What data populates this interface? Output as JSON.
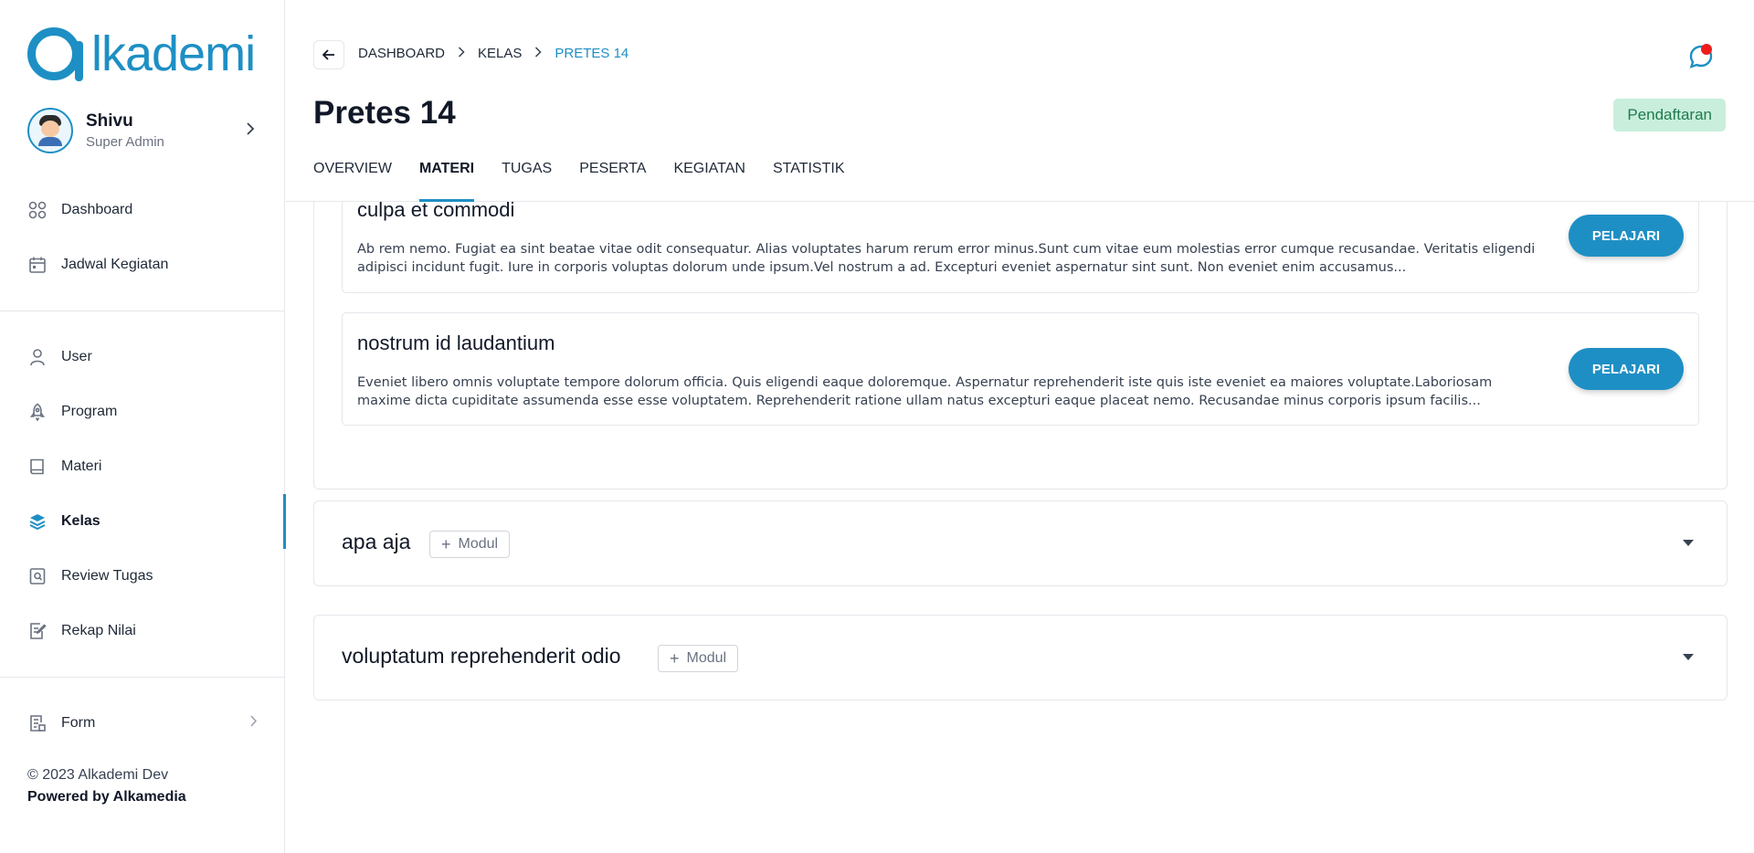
{
  "brand": {
    "logo_text": "lkademi",
    "accent_color": "#1e8fc4"
  },
  "profile": {
    "name": "Shivu",
    "role": "Super Admin"
  },
  "sidebar": {
    "primary": [
      {
        "label": "Dashboard",
        "icon": "dashboard-grid-icon"
      },
      {
        "label": "Jadwal Kegiatan",
        "icon": "calendar-icon"
      }
    ],
    "secondary": [
      {
        "label": "User",
        "icon": "user-icon"
      },
      {
        "label": "Program",
        "icon": "rocket-icon"
      },
      {
        "label": "Materi",
        "icon": "book-icon"
      },
      {
        "label": "Kelas",
        "icon": "layers-icon",
        "active": true
      },
      {
        "label": "Review Tugas",
        "icon": "review-icon"
      },
      {
        "label": "Rekap Nilai",
        "icon": "edit-list-icon"
      }
    ],
    "form": {
      "label": "Form",
      "icon": "form-icon"
    }
  },
  "footer": {
    "copyright": "© 2023 Alkademi Dev",
    "powered": "Powered by Alkamedia"
  },
  "header": {
    "breadcrumb": [
      "DASHBOARD",
      "KELAS",
      "PRETES 14"
    ],
    "title": "Pretes 14",
    "status": "Pendaftaran",
    "status_color": "#c9efdc",
    "tabs": [
      "OVERVIEW",
      "MATERI",
      "TUGAS",
      "PESERTA",
      "KEGIATAN",
      "STATISTIK"
    ],
    "active_tab": "MATERI"
  },
  "lessons": [
    {
      "title": "culpa et commodi",
      "description": "Ab rem nemo. Fugiat ea sint beatae vitae odit consequatur. Alias voluptates harum rerum error minus.Sunt cum vitae eum molestias error cumque recusandae. Veritatis eligendi adipisci incidunt fugit. Iure in corporis voluptas dolorum unde ipsum.Vel nostrum a ad. Excepturi eveniet aspernatur sint sunt. Non eveniet enim accusamus...",
      "button": "PELAJARI"
    },
    {
      "title": "nostrum id laudantium",
      "description": "Eveniet libero omnis voluptate tempore dolorum officia. Quis eligendi eaque doloremque. Aspernatur reprehenderit iste quis iste eveniet ea maiores voluptate.Laboriosam maxime dicta cupiditate assumenda esse esse voluptatem. Reprehenderit ratione ullam natus excepturi eaque placeat nemo. Recusandae minus corporis ipsum facilis...",
      "button": "PELAJARI"
    }
  ],
  "modules": [
    {
      "title": "apa aja",
      "add_label": "Modul"
    },
    {
      "title": "voluptatum reprehenderit odio",
      "add_label": "Modul"
    }
  ]
}
